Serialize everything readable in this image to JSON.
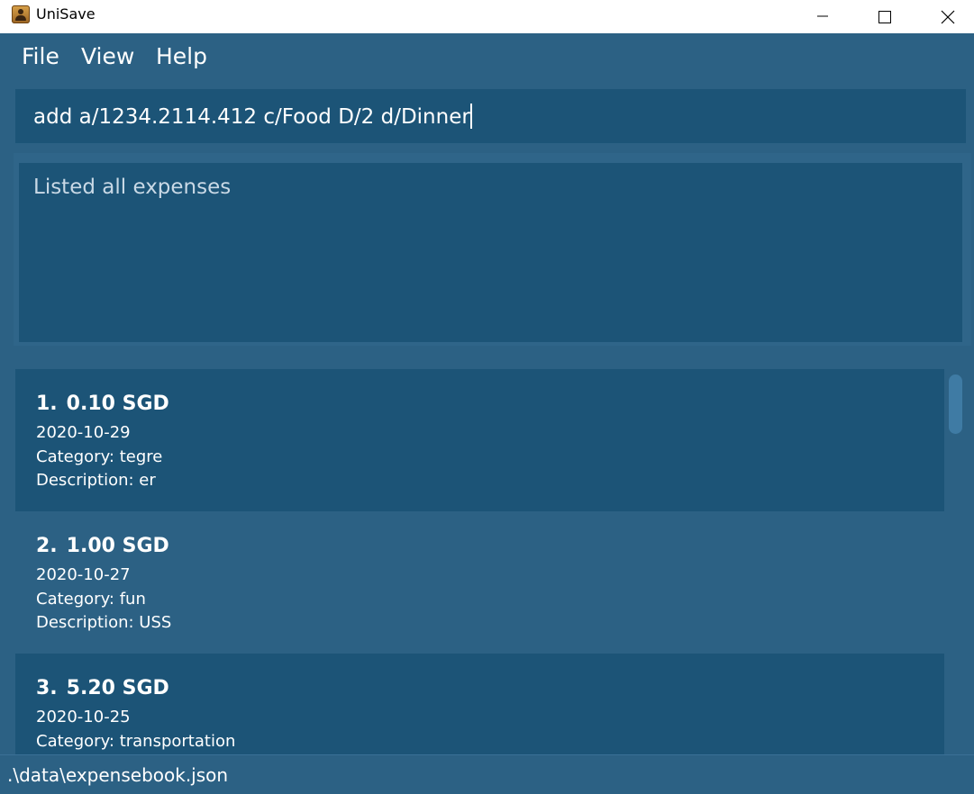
{
  "window": {
    "title": "UniSave"
  },
  "menu": {
    "file": "File",
    "view": "View",
    "help": "Help"
  },
  "command": {
    "value": "add a/1234.2114.412 c/Food D/2 d/Dinner"
  },
  "result": {
    "message": "Listed all expenses"
  },
  "expenses": [
    {
      "index": "1.",
      "amount": "0.10 SGD",
      "date": "2020-10-29",
      "category": "Category: tegre",
      "description": "Description: er"
    },
    {
      "index": "2.",
      "amount": "1.00 SGD",
      "date": "2020-10-27",
      "category": "Category: fun",
      "description": "Description: USS"
    },
    {
      "index": "3.",
      "amount": "5.20 SGD",
      "date": "2020-10-25",
      "category": "Category: transportation",
      "description": ""
    }
  ],
  "status": {
    "path": ".\\data\\expensebook.json"
  },
  "colors": {
    "window_bg": "#2c6184",
    "panel_bg": "#1c5477",
    "text": "#ffffff"
  },
  "icons": {
    "app": "app-user-icon",
    "minimize": "minimize-icon",
    "maximize": "maximize-icon",
    "close": "close-icon"
  }
}
